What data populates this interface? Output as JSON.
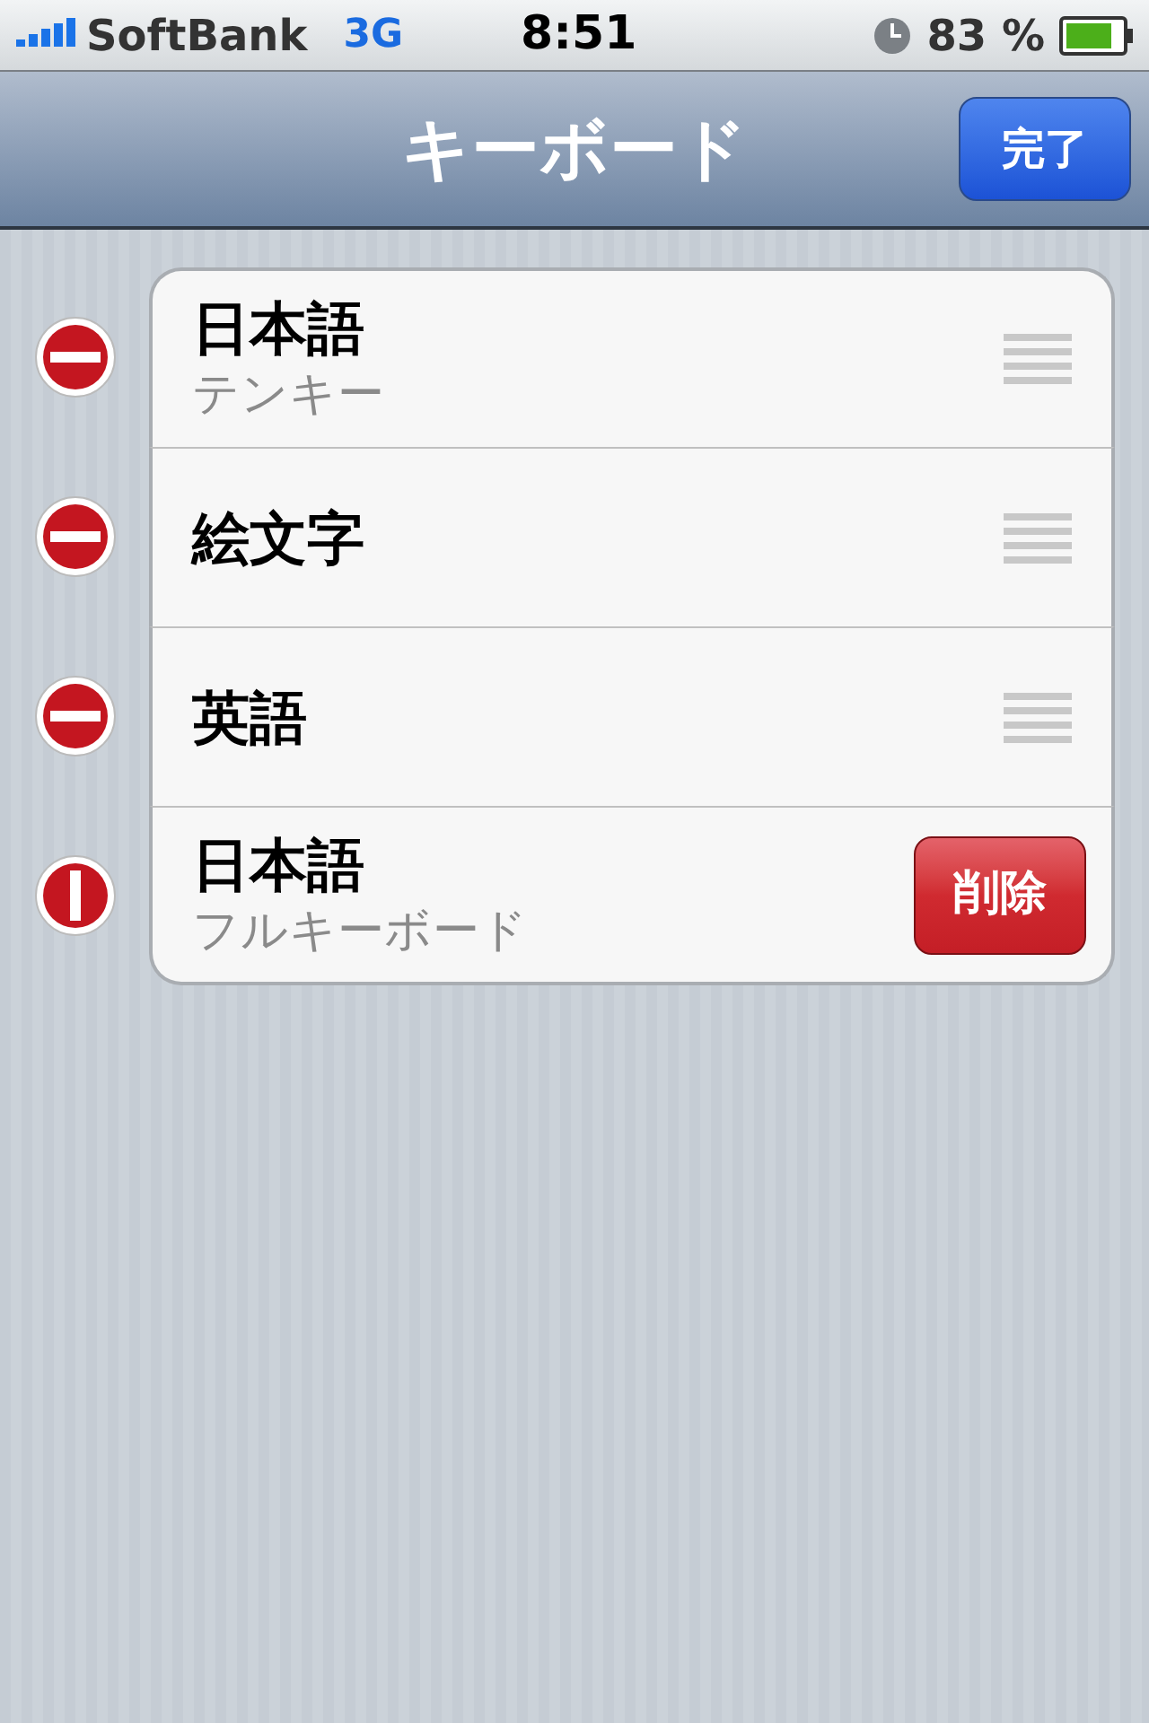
{
  "status_bar": {
    "carrier": "SoftBank",
    "network": "3G",
    "time": "8:51",
    "battery": "83 %"
  },
  "nav_bar": {
    "title": "キーボード",
    "done_button": "完了"
  },
  "keyboards": [
    {
      "name": "日本語",
      "subtitle": "テンキー",
      "deleting": false
    },
    {
      "name": "絵文字",
      "deleting": false
    },
    {
      "name": "英語",
      "deleting": false
    },
    {
      "name": "日本語",
      "subtitle": "フルキーボード",
      "deleting": true,
      "delete_button": "削除"
    }
  ]
}
